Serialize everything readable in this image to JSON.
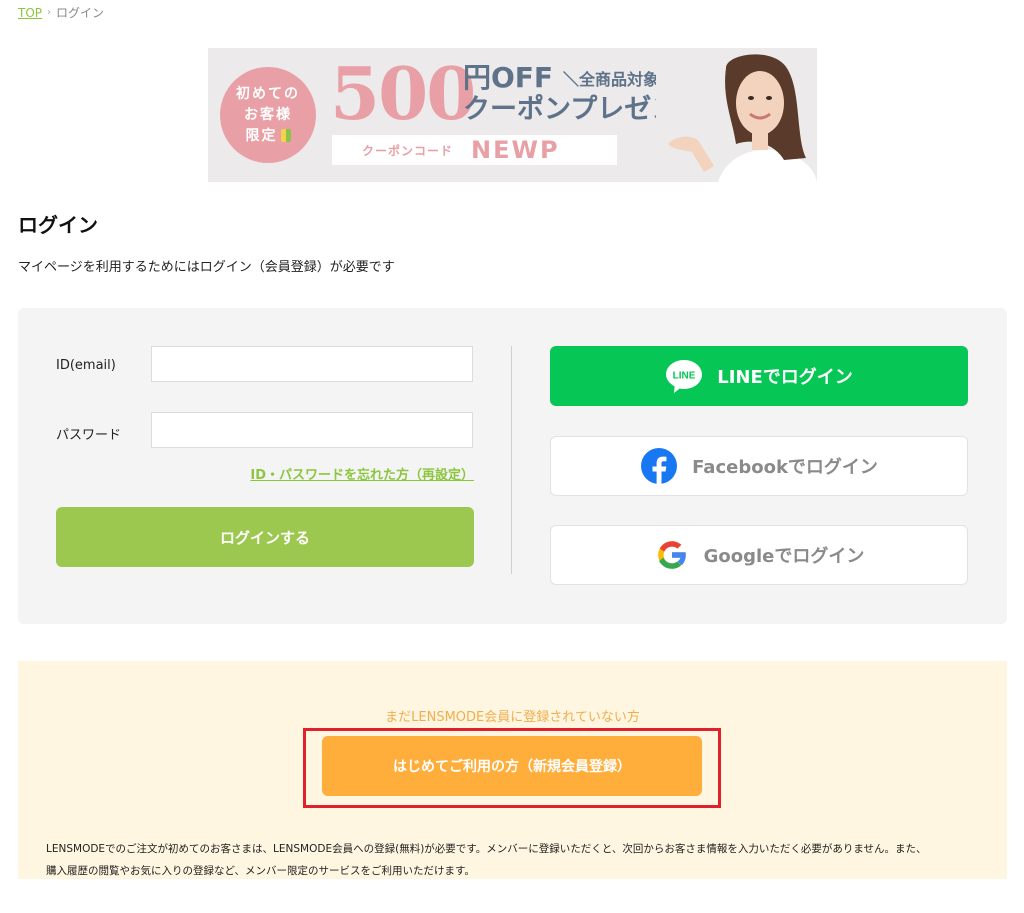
{
  "breadcrumb": {
    "home": "TOP",
    "separator": "›",
    "current": "ログイン"
  },
  "banner": {
    "badge_line1": "初めての",
    "badge_line2": "お客様",
    "badge_line3": "限定",
    "amount": "500",
    "yen_off": "円OFF",
    "all_products": "＼全商品対象／",
    "present": "クーポンプレゼント!",
    "code_label": "クーポンコード",
    "code_value": "NEWP",
    "colors": {
      "pink": "#e8a0a6",
      "navy": "#5e7289"
    }
  },
  "page": {
    "title": "ログイン",
    "description": "マイページを利用するためにはログイン（会員登録）が必要です"
  },
  "login_form": {
    "id_label": "ID(email)",
    "id_value": "",
    "password_label": "パスワード",
    "password_value": "",
    "forgot_link": "ID・パスワードを忘れた方（再設定）",
    "submit_label": "ログインする",
    "submit_color": "#9dc850"
  },
  "social_login": {
    "line": {
      "label": "LINEでログイン",
      "icon": "line-icon",
      "icon_text": "LINE",
      "color": "#06c755"
    },
    "facebook": {
      "label": "Facebookでログイン",
      "icon": "facebook-icon",
      "color": "#1877f2"
    },
    "google": {
      "label": "Googleでログイン",
      "icon": "google-icon"
    }
  },
  "register": {
    "lead": "まだLENSMODE会員に登録されていない方",
    "button_label": "はじめてご利用の方（新規会員登録）",
    "button_color": "#ffad3b",
    "highlight_color": "#e0202a",
    "note_line1": "LENSMODEでのご注文が初めてのお客さまは、LENSMODE会員への登録(無料)が必要です。メンバーに登録いただくと、次回からお客さま情報を入力いただく必要がありません。また、",
    "note_line2": "購入履歴の閲覧やお気に入りの登録など、メンバー限定のサービスをご利用いただけます。"
  }
}
